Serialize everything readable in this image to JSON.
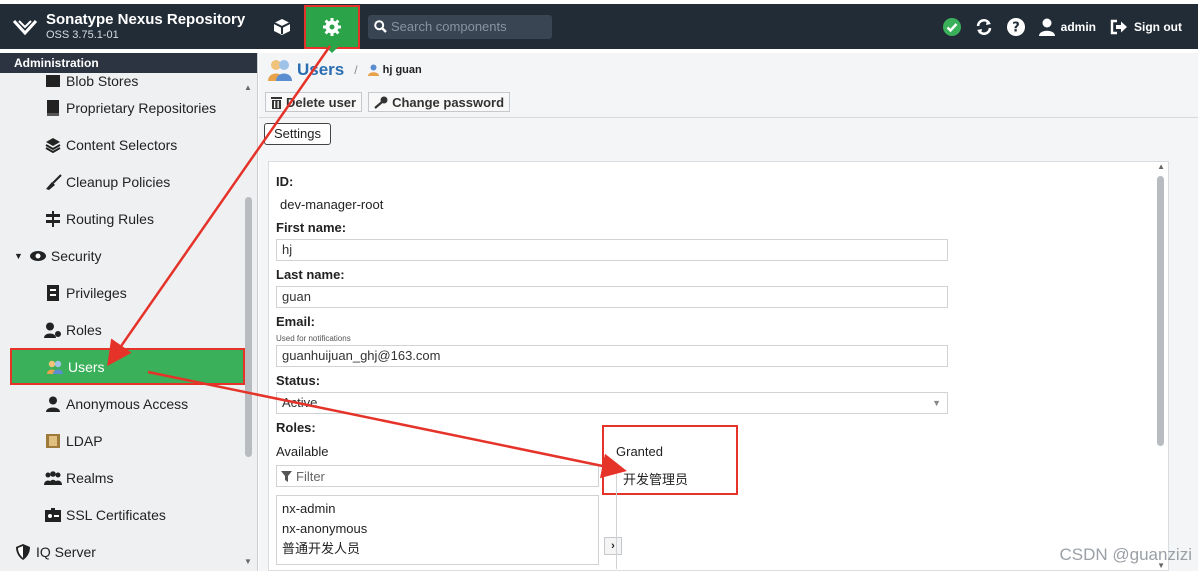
{
  "header": {
    "brand_title": "Sonatype Nexus Repository",
    "brand_version": "OSS 3.75.1-01",
    "search_placeholder": "Search components",
    "user_label": "admin",
    "signout_label": "Sign out"
  },
  "sidebar": {
    "title": "Administration",
    "items": [
      {
        "label": "Blob Stores",
        "icon": "database-icon"
      },
      {
        "label": "Proprietary Repositories",
        "icon": "book-icon"
      },
      {
        "label": "Content Selectors",
        "icon": "layers-icon"
      },
      {
        "label": "Cleanup Policies",
        "icon": "broom-icon"
      },
      {
        "label": "Routing Rules",
        "icon": "signpost-icon"
      },
      {
        "label": "Security",
        "icon": "eye-icon"
      },
      {
        "label": "Privileges",
        "icon": "id-card-icon"
      },
      {
        "label": "Roles",
        "icon": "user-gear-icon"
      },
      {
        "label": "Users",
        "icon": "users-icon"
      },
      {
        "label": "Anonymous Access",
        "icon": "user-icon"
      },
      {
        "label": "LDAP",
        "icon": "book-icon"
      },
      {
        "label": "Realms",
        "icon": "users-group-icon"
      },
      {
        "label": "SSL Certificates",
        "icon": "certificate-icon"
      },
      {
        "label": "IQ Server",
        "icon": "shield-icon"
      }
    ]
  },
  "breadcrumb": {
    "title": "Users",
    "sub": "hj guan"
  },
  "toolbar": {
    "delete_label": "Delete user",
    "change_password_label": "Change password"
  },
  "tabs": {
    "settings_label": "Settings"
  },
  "form": {
    "id_label": "ID:",
    "id_value": "dev-manager-root",
    "first_name_label": "First name:",
    "first_name_value": "hj",
    "last_name_label": "Last name:",
    "last_name_value": "guan",
    "email_label": "Email:",
    "email_help": "Used for notifications",
    "email_value": "guanhuijuan_ghj@163.com",
    "status_label": "Status:",
    "status_value": "Active",
    "roles_label": "Roles:",
    "available_label": "Available",
    "granted_label": "Granted",
    "filter_placeholder": "Filter",
    "available_roles": [
      "nx-admin",
      "nx-anonymous",
      "普通开发人员"
    ],
    "granted_roles": [
      "开发管理员"
    ]
  },
  "watermark": "CSDN @guanzizi",
  "colors": {
    "header_bg": "#222c37",
    "accent_green": "#3bb05a",
    "annotation_red": "#e5332a",
    "link_blue": "#2a6db0"
  }
}
